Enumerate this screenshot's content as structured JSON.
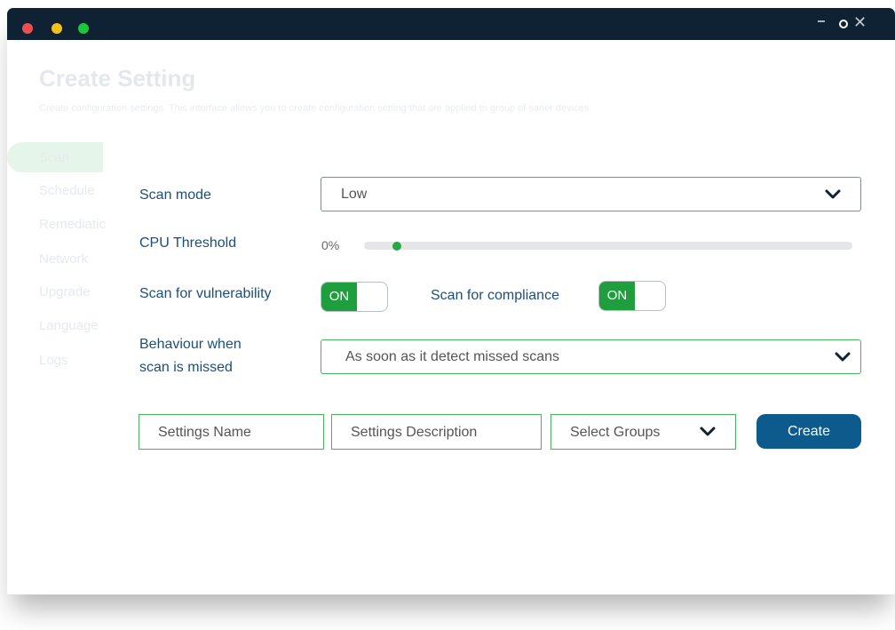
{
  "window": {
    "controls": {
      "minimize_icon": "minimize-icon",
      "maximize_icon": "circle-icon",
      "close_glyph": "✕"
    }
  },
  "header": {
    "title": "Create Setting",
    "subtitle": "Create configuration settings. This interface allows you to create configuration setting that are applied to group of saner devices"
  },
  "sidebar": {
    "items": [
      {
        "label": "Scan",
        "active": true
      },
      {
        "label": "Schedule"
      },
      {
        "label": "Remediation"
      },
      {
        "label": "Network"
      },
      {
        "label": "Upgrade"
      },
      {
        "label": "Language"
      },
      {
        "label": "Logs"
      }
    ]
  },
  "form": {
    "scan_mode": {
      "label": "Scan mode",
      "value": "Low"
    },
    "cpu_threshold": {
      "label": "CPU Threshold",
      "value_text": "0%",
      "level": 0.06
    },
    "scan_vulnerability": {
      "label": "Scan for vulnerability",
      "state": "ON"
    },
    "scan_compliance": {
      "label": "Scan for compliance",
      "state": "ON"
    },
    "behaviour": {
      "label_line1": "Behaviour when",
      "label_line2": "scan is missed",
      "value": "As soon as it detect missed scans"
    },
    "settings_name": {
      "placeholder": "Settings Name"
    },
    "settings_description": {
      "placeholder": "Settings Description"
    },
    "select_groups": {
      "placeholder": "Select Groups"
    },
    "create_label": "Create"
  },
  "colors": {
    "titlebar": "#0e2233",
    "accent_green": "#1e9e3c",
    "border_green": "#45b45a",
    "label_blue": "#1b4f7a",
    "button_blue": "#0d5a8c"
  }
}
